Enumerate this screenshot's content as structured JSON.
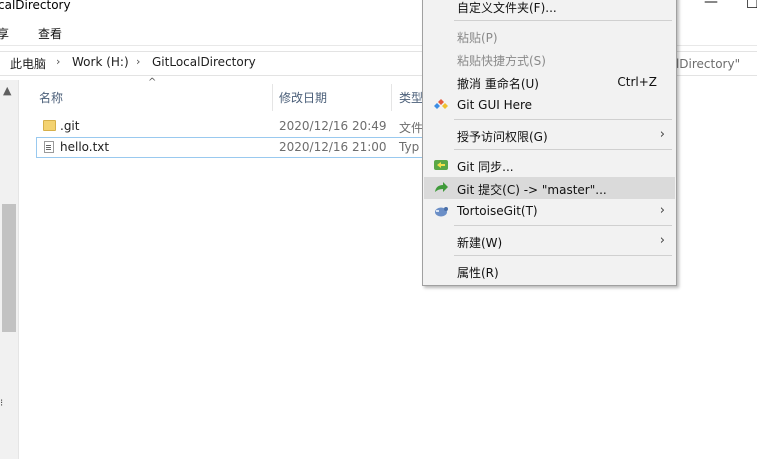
{
  "window": {
    "title": "calDirectory",
    "minimize": "—",
    "maximize": "☐"
  },
  "ribbon": {
    "tabs": [
      "享",
      "查看"
    ]
  },
  "address": {
    "crumbs": [
      "此电脑",
      "Work (H:)",
      "GitLocalDirectory"
    ],
    "search_hint": "calDirectory\""
  },
  "filelist": {
    "columns": {
      "name": "名称",
      "modified": "修改日期",
      "type": "类型"
    },
    "rows": [
      {
        "name": ".git",
        "modified": "2020/12/16 20:49",
        "type": "文件"
      },
      {
        "name": "hello.txt",
        "modified": "2020/12/16 21:00",
        "type": "Typ"
      }
    ]
  },
  "context_menu": {
    "items": [
      {
        "label": "自定义文件夹(F)..."
      },
      {
        "label": "粘贴(P)",
        "disabled": true
      },
      {
        "label": "粘贴快捷方式(S)",
        "disabled": true
      },
      {
        "label": "撤消 重命名(U)",
        "shortcut": "Ctrl+Z"
      },
      {
        "label": "Git GUI Here",
        "icon": "git-gui-icon"
      },
      {
        "label": "授予访问权限(G)",
        "submenu": true
      },
      {
        "label": "Git 同步...",
        "icon": "git-sync-icon"
      },
      {
        "label": "Git 提交(C) -> \"master\"...",
        "icon": "git-commit-icon",
        "highlighted": true
      },
      {
        "label": "TortoiseGit(T)",
        "icon": "tortoisegit-icon",
        "submenu": true
      },
      {
        "label": "新建(W)",
        "submenu": true
      },
      {
        "label": "属性(R)"
      }
    ],
    "submenu_arrow": "›"
  },
  "colors": {
    "selection_border": "#99c9ef",
    "menu_bg": "#f2f2f2",
    "menu_highlight": "#dadada",
    "header_text": "#4c607a"
  }
}
